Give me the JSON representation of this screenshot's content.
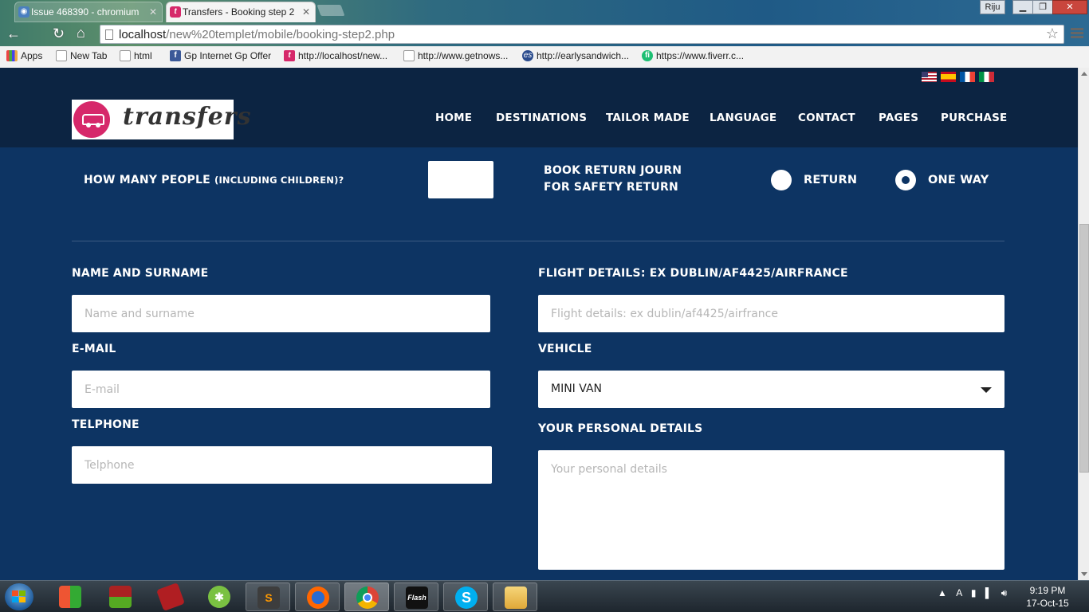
{
  "browser": {
    "tabs": [
      {
        "title": "Issue 468390 - chromium",
        "favicon": "chromium-issue-icon",
        "active": false
      },
      {
        "title": "Transfers - Booking step 2",
        "favicon": "transfers-t-icon",
        "active": true
      }
    ],
    "window_user": "Riju",
    "url_host": "localhost",
    "url_path": "/new%20templet/mobile/booking-step2.php",
    "bookmarks": [
      {
        "label": "Apps",
        "icon": "apps-grid-icon"
      },
      {
        "label": "New Tab",
        "icon": "page-icon"
      },
      {
        "label": "html",
        "icon": "page-icon"
      },
      {
        "label": "Gp Internet Gp Offer",
        "icon": "facebook-icon"
      },
      {
        "label": "http://localhost/new...",
        "icon": "transfers-t-icon"
      },
      {
        "label": "http://www.getnows...",
        "icon": "page-icon"
      },
      {
        "label": "http://earlysandwich...",
        "icon": "es-icon"
      },
      {
        "label": "https://www.fiverr.c...",
        "icon": "fiverr-icon"
      }
    ]
  },
  "header": {
    "logo_text": "transfers",
    "flags": [
      "flag-us-icon",
      "flag-es-icon",
      "flag-fr-icon",
      "flag-it-icon"
    ],
    "nav": [
      "HOME",
      "DESTINATIONS",
      "TAILOR MADE",
      "LANGUAGE",
      "CONTACT",
      "PAGES",
      "PURCHASE"
    ]
  },
  "form": {
    "people_label": "HOW MANY PEOPLE",
    "people_label_small": "(INCLUDING CHILDREN)?",
    "people_value": "",
    "return_label_line1": "BOOK RETURN JOURN",
    "return_label_line2": "FOR SAFETY RETURN",
    "radio_return": "RETURN",
    "radio_oneway": "ONE WAY",
    "selected_journey": "ONE WAY",
    "name_label": "NAME AND SURNAME",
    "name_placeholder": "Name and surname",
    "email_label": "E-MAIL",
    "email_placeholder": "E-mail",
    "phone_label": "TELPHONE",
    "phone_placeholder": "Telphone",
    "flight_label": "FLIGHT DETAILS: EX DUBLIN/AF4425/AIRFRANCE",
    "flight_placeholder": "Flight details: ex dublin/af4425/airfrance",
    "vehicle_label": "VEHICLE",
    "vehicle_value": "MINI VAN",
    "personal_label": "YOUR PERSONAL DETAILS",
    "personal_placeholder": "Your personal details"
  },
  "colors": {
    "header_bg": "#0c2442",
    "content_bg": "#0d3463",
    "brand_pink": "#d6286a"
  },
  "taskbar": {
    "items": [
      "windows-flag-icon",
      "winrar-icon",
      "book-icon",
      "greenfolder-icon",
      "sublime-icon",
      "firefox-icon",
      "chrome-icon",
      "flash-icon",
      "skype-icon",
      "explorer-icon"
    ],
    "time": "9:19 PM",
    "date": "17-Oct-15"
  }
}
